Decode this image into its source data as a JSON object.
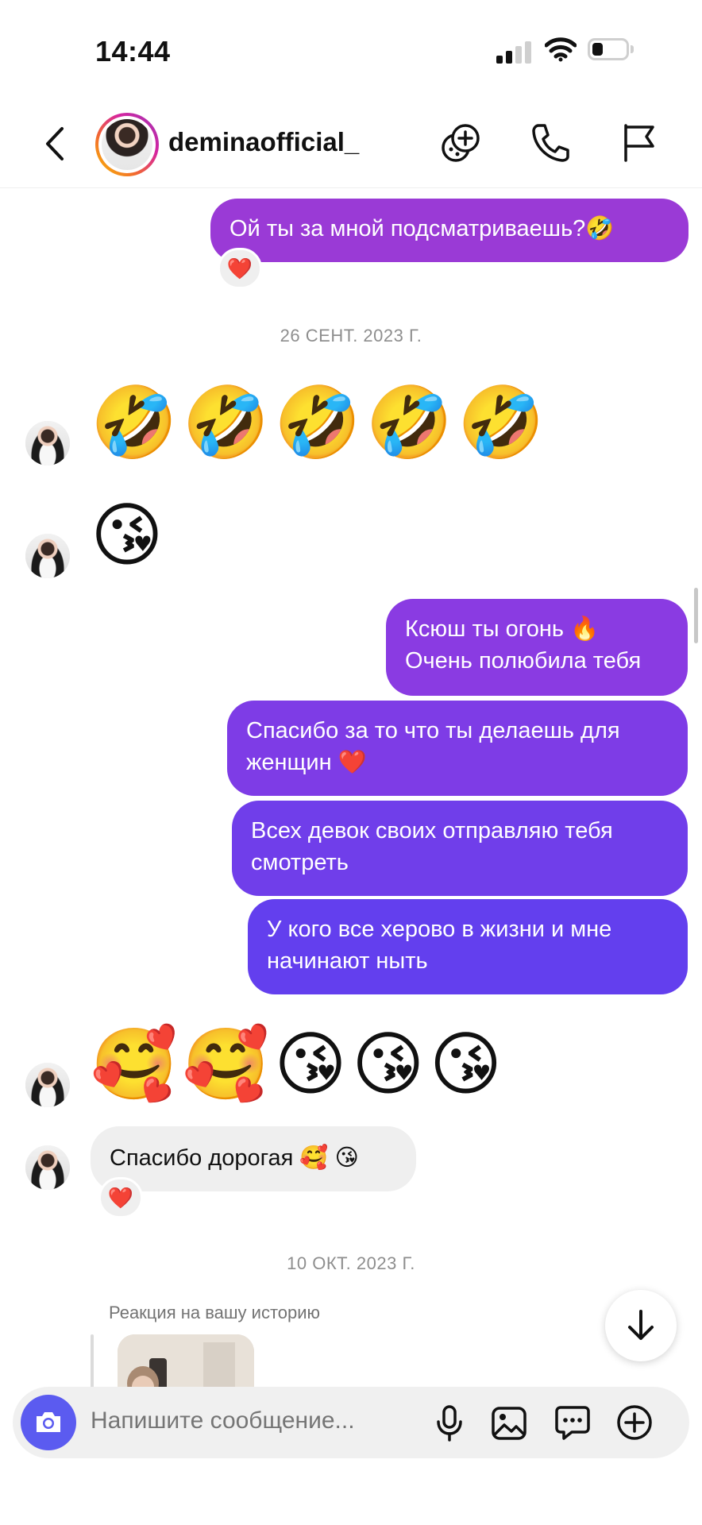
{
  "status_bar": {
    "time": "14:44"
  },
  "header": {
    "username": "deminaofficial_"
  },
  "messages": {
    "out_top": "Ой ты за мной подсматриваешь?🤣",
    "out_top_reaction": "❤️",
    "date1": "26 СЕНТ. 2023 Г.",
    "in_emoji_1": "🤣🤣🤣🤣🤣",
    "in_emoji_2": "😘",
    "out_1": "Ксюш ты огонь 🔥\nОчень полюбила тебя",
    "out_2": "Спасибо за то что ты делаешь для\nженщин ❤️",
    "out_3": "Всех девок своих отправляю тебя\nсмотреть",
    "out_4": "У кого все херово в жизни и мне\nначинают ныть",
    "in_emoji_3": "🥰🥰😘😘😘",
    "in_text": "Спасибо дорогая 🥰 😘",
    "in_text_reaction": "❤️",
    "date2": "10 ОКТ. 2023 Г.",
    "story_reaction_label": "Реакция на вашу историю"
  },
  "composer": {
    "placeholder": "Напишите сообщение..."
  },
  "icons": {
    "back": "chevron-left-icon",
    "effects": "effects-plus-icon",
    "call": "phone-icon",
    "flag": "flag-icon",
    "camera": "camera-icon",
    "mic": "microphone-icon",
    "gallery": "image-icon",
    "sticker": "chat-sticker-icon",
    "plus": "plus-circle-icon",
    "scroll": "arrow-down-icon"
  },
  "colors": {
    "bubble_top": "#9a3ad6",
    "bubble_grad_start": "#8b3ae0",
    "bubble_grad_end": "#5b3df0",
    "camera_bg": "#5b5bf0"
  }
}
